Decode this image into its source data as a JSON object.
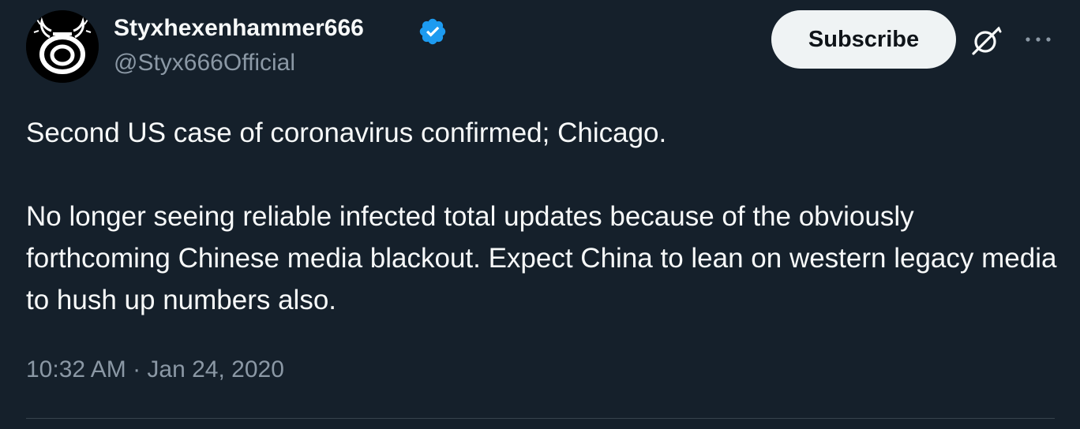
{
  "author": {
    "display_name": "Styxhexenhammer666",
    "handle": "@Styx666Official",
    "verified": true,
    "avatar_icon": "horned-omega-logo-icon"
  },
  "actions": {
    "subscribe_label": "Subscribe",
    "grok_icon": "grok-icon",
    "more_icon": "more-icon"
  },
  "tweet": {
    "paragraphs": [
      "Second US case of coronavirus confirmed; Chicago.",
      "No longer seeing reliable infected total updates because of the obviously forthcoming Chinese media blackout. Expect China to lean on western legacy media to hush up numbers also."
    ],
    "timestamp": "10:32 AM · Jan 24, 2020"
  },
  "colors": {
    "background": "#15202b",
    "text_primary": "#f7f9f9",
    "text_secondary": "#8b98a5",
    "verified_badge": "#1d9bf0",
    "subscribe_bg": "#eff3f4",
    "divider": "#38444d"
  }
}
